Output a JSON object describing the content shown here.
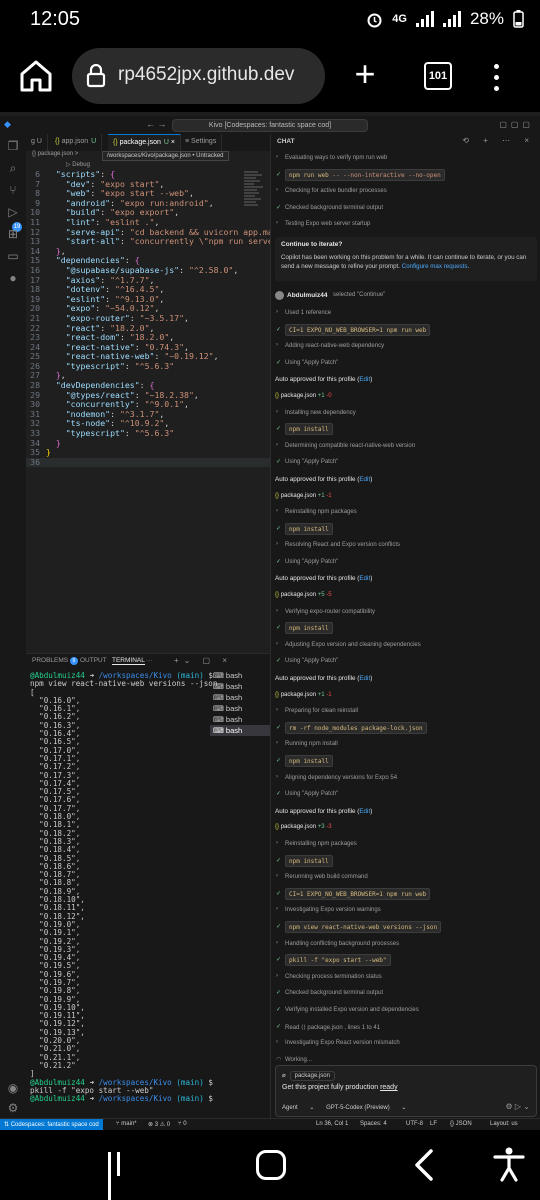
{
  "status_bar": {
    "time": "12:05",
    "network": "4G",
    "battery": "28%"
  },
  "browser": {
    "url": "rp4652jpx.github.dev",
    "tab_count": "101"
  },
  "vscode": {
    "command_center": "Kivo [Codespaces: fantastic space cod]",
    "tabs": [
      {
        "label": "g U"
      },
      {
        "label": "app.json",
        "status": "U"
      },
      {
        "label": "package.json",
        "status": "U"
      },
      {
        "label": "Settings"
      }
    ],
    "breadcrumb": "package.json >",
    "peek": "▷ Debug",
    "tooltip": "/workspaces/Kivo/package.json • Untracked",
    "code": [
      {
        "n": "6",
        "html": "  <span class='k'>\"scripts\"</span><span class='p'>: </span><span class='b2'>{</span>"
      },
      {
        "n": "7",
        "html": "    <span class='k'>\"dev\"</span><span class='p'>: </span><span class='s'>\"expo start\"</span><span class='p'>,</span>"
      },
      {
        "n": "8",
        "html": "    <span class='k'>\"web\"</span><span class='p'>: </span><span class='s'>\"expo start --web\"</span><span class='p'>,</span>"
      },
      {
        "n": "9",
        "html": "    <span class='k'>\"android\"</span><span class='p'>: </span><span class='s'>\"expo run:android\"</span><span class='p'>,</span>"
      },
      {
        "n": "10",
        "html": "    <span class='k'>\"build\"</span><span class='p'>: </span><span class='s'>\"expo export\"</span><span class='p'>,</span>"
      },
      {
        "n": "11",
        "html": "    <span class='k'>\"lint\"</span><span class='p'>: </span><span class='s'>\"eslint .\"</span><span class='p'>,</span>"
      },
      {
        "n": "12",
        "html": "    <span class='k'>\"serve-api\"</span><span class='p'>: </span><span class='s'>\"cd backend &amp;&amp; uvicorn app.ma</span>"
      },
      {
        "n": "13",
        "html": "    <span class='k'>\"start-all\"</span><span class='p'>: </span><span class='s'>\"concurrently \\\"npm run serve</span>"
      },
      {
        "n": "14",
        "html": "  <span class='b2'>}</span><span class='p'>,</span>"
      },
      {
        "n": "15",
        "html": "  <span class='k'>\"dependencies\"</span><span class='p'>: </span><span class='b2'>{</span>"
      },
      {
        "n": "16",
        "html": "    <span class='k'>\"@supabase/supabase-js\"</span><span class='p'>: </span><span class='s'>\"^2.58.0\"</span><span class='p'>,</span>"
      },
      {
        "n": "17",
        "html": "    <span class='k'>\"axios\"</span><span class='p'>: </span><span class='s'>\"^1.7.7\"</span><span class='p'>,</span>"
      },
      {
        "n": "18",
        "html": "    <span class='k'>\"dotenv\"</span><span class='p'>: </span><span class='s'>\"^16.4.5\"</span><span class='p'>,</span>"
      },
      {
        "n": "19",
        "html": "    <span class='k'>\"eslint\"</span><span class='p'>: </span><span class='s'>\"^9.13.0\"</span><span class='p'>,</span>"
      },
      {
        "n": "20",
        "html": "    <span class='k'>\"expo\"</span><span class='p'>: </span><span class='s'>\"~54.0.12\"</span><span class='p'>,</span>"
      },
      {
        "n": "21",
        "html": "    <span class='k'>\"expo-router\"</span><span class='p'>: </span><span class='s'>\"~3.5.17\"</span><span class='p'>,</span>"
      },
      {
        "n": "22",
        "html": "    <span class='k'>\"react\"</span><span class='p'>: </span><span class='s'>\"18.2.0\"</span><span class='p'>,</span>"
      },
      {
        "n": "23",
        "html": "    <span class='k'>\"react-dom\"</span><span class='p'>: </span><span class='s'>\"18.2.0\"</span><span class='p'>,</span>"
      },
      {
        "n": "24",
        "html": "    <span class='k'>\"react-native\"</span><span class='p'>: </span><span class='s'>\"0.74.3\"</span><span class='p'>,</span>"
      },
      {
        "n": "25",
        "html": "    <span class='k'>\"react-native-web\"</span><span class='p'>: </span><span class='s'>\"~0.19.12\"</span><span class='p'>,</span>"
      },
      {
        "n": "26",
        "html": "    <span class='k'>\"typescript\"</span><span class='p'>: </span><span class='s'>\"^5.6.3\"</span>"
      },
      {
        "n": "27",
        "html": "  <span class='b2'>}</span><span class='p'>,</span>"
      },
      {
        "n": "28",
        "html": "  <span class='k'>\"devDependencies\"</span><span class='p'>: </span><span class='b2'>{</span>"
      },
      {
        "n": "29",
        "html": "    <span class='k'>\"@types/react\"</span><span class='p'>: </span><span class='s'>\"~18.2.38\"</span><span class='p'>,</span>"
      },
      {
        "n": "30",
        "html": "    <span class='k'>\"concurrently\"</span><span class='p'>: </span><span class='s'>\"^9.0.1\"</span><span class='p'>,</span>"
      },
      {
        "n": "31",
        "html": "    <span class='k'>\"nodemon\"</span><span class='p'>: </span><span class='s'>\"^3.1.7\"</span><span class='p'>,</span>"
      },
      {
        "n": "32",
        "html": "    <span class='k'>\"ts-node\"</span><span class='p'>: </span><span class='s'>\"^10.9.2\"</span><span class='p'>,</span>"
      },
      {
        "n": "33",
        "html": "    <span class='k'>\"typescript\"</span><span class='p'>: </span><span class='s'>\"^5.6.3\"</span>"
      },
      {
        "n": "34",
        "html": "  <span class='b2'>}</span>"
      },
      {
        "n": "35",
        "html": "<span class='b'>}</span>"
      },
      {
        "n": "36",
        "html": ""
      }
    ],
    "panel": {
      "tabs": [
        "PROBLEMS",
        "OUTPUT",
        "TERMINAL",
        "···"
      ],
      "problems_count": "9",
      "terminal_list": [
        "bash",
        "bash",
        "bash",
        "bash",
        "bash",
        "bash"
      ],
      "terminal_html": "<span class='pr'>@Abdulmuiz44</span> <span class='p'>➜</span> <span class='dir'>/workspaces/Kivo</span> <span class='br'>(main)</span> $\nnpm view react-native-web versions --json\n[\n  \"0.16.0\",\n  \"0.16.1\",\n  \"0.16.2\",\n  \"0.16.3\",\n  \"0.16.4\",\n  \"0.16.5\",\n  \"0.17.0\",\n  \"0.17.1\",\n  \"0.17.2\",\n  \"0.17.3\",\n  \"0.17.4\",\n  \"0.17.5\",\n  \"0.17.6\",\n  \"0.17.7\",\n  \"0.18.0\",\n  \"0.18.1\",\n  \"0.18.2\",\n  \"0.18.3\",\n  \"0.18.4\",\n  \"0.18.5\",\n  \"0.18.6\",\n  \"0.18.7\",\n  \"0.18.8\",\n  \"0.18.9\",\n  \"0.18.10\",\n  \"0.18.11\",\n  \"0.18.12\",\n  \"0.19.0\",\n  \"0.19.1\",\n  \"0.19.2\",\n  \"0.19.3\",\n  \"0.19.4\",\n  \"0.19.5\",\n  \"0.19.6\",\n  \"0.19.7\",\n  \"0.19.8\",\n  \"0.19.9\",\n  \"0.19.10\",\n  \"0.19.11\",\n  \"0.19.12\",\n  \"0.19.13\",\n  \"0.20.0\",\n  \"0.21.0\",\n  \"0.21.1\",\n  \"0.21.2\"\n]\n<span class='pr'>@Abdulmuiz44</span> <span class='p'>➜</span> <span class='dir'>/workspaces/Kivo</span> <span class='br'>(main)</span> $\npkill -f \"expo start --web\"\n<span class='pr'>@Abdulmuiz44</span> <span class='p'>➜</span> <span class='dir'>/workspaces/Kivo</span> <span class='br'>(main)</span> $"
    },
    "chat": {
      "header": "CHAT",
      "items": [
        {
          "k": "txt",
          "g": "›",
          "t": "Evaluating ways to verify npm run web"
        },
        {
          "k": "code",
          "g": "✓",
          "t": "<span class='kw'>npm run web</span> <span class='ag'>-- --non-interactive --no-open</span>"
        },
        {
          "k": "txt",
          "g": "›",
          "t": "Checking for active bundler processes"
        },
        {
          "k": "txt",
          "g": "✓",
          "ok": true,
          "t": "Checked background terminal output"
        },
        {
          "k": "txt",
          "g": "›",
          "t": "Testing Expo web server startup"
        },
        {
          "k": "note",
          "t": "Continue to iterate?",
          "d": "Copilot has been working on this problem for a while. It can continue to iterate, or you can send a new message to refine your prompt. <a>Configure max requests</a>."
        },
        {
          "k": "user",
          "name": "Abdulmuiz44",
          "sel": "selected \"Continue\""
        },
        {
          "k": "txt",
          "g": "›",
          "t": "Used 1 reference"
        },
        {
          "k": "code",
          "g": "✓",
          "t": "<span class='kw'>CI=1 EXPO_NO_WEB_BROWSER=1 npm run web</span>"
        },
        {
          "k": "txt",
          "g": "›",
          "t": "Adding react-native-web dependency"
        },
        {
          "k": "txt",
          "g": "✓",
          "ok": true,
          "t": "Using \"Apply Patch\""
        },
        {
          "k": "auto",
          "t": "Auto approved for this profile (",
          "e": "Edit",
          "z": ")"
        },
        {
          "k": "file",
          "f": "package.json",
          "p": "+1",
          "m": "-0"
        },
        {
          "k": "txt",
          "g": "›",
          "t": "Installing new dependency"
        },
        {
          "k": "code",
          "g": "✓",
          "t": "<span class='kw'>npm install</span>"
        },
        {
          "k": "txt",
          "g": "›",
          "t": "Determining compatible react-native-web version"
        },
        {
          "k": "txt",
          "g": "✓",
          "ok": true,
          "t": "Using \"Apply Patch\""
        },
        {
          "k": "auto",
          "t": "Auto approved for this profile (",
          "e": "Edit",
          "z": ")"
        },
        {
          "k": "file",
          "f": "package.json",
          "p": "+1",
          "m": "-1"
        },
        {
          "k": "txt",
          "g": "›",
          "t": "Reinstalling npm packages"
        },
        {
          "k": "code",
          "g": "✓",
          "t": "<span class='kw'>npm install</span>"
        },
        {
          "k": "txt",
          "g": "›",
          "t": "Resolving React and Expo version conflicts"
        },
        {
          "k": "txt",
          "g": "✓",
          "ok": true,
          "t": "Using \"Apply Patch\""
        },
        {
          "k": "auto",
          "t": "Auto approved for this profile (",
          "e": "Edit",
          "z": ")"
        },
        {
          "k": "file",
          "f": "package.json",
          "p": "+5",
          "m": "-5"
        },
        {
          "k": "txt",
          "g": "›",
          "t": "Verifying expo-router compatibility"
        },
        {
          "k": "code",
          "g": "✓",
          "t": "<span class='kw'>npm install</span>"
        },
        {
          "k": "txt",
          "g": "›",
          "t": "Adjusting Expo version and cleaning dependencies"
        },
        {
          "k": "txt",
          "g": "✓",
          "ok": true,
          "t": "Using \"Apply Patch\""
        },
        {
          "k": "auto",
          "t": "Auto approved for this profile (",
          "e": "Edit",
          "z": ")"
        },
        {
          "k": "file",
          "f": "package.json",
          "p": "+1",
          "m": "-1"
        },
        {
          "k": "txt",
          "g": "›",
          "t": "Preparing for clean reinstall"
        },
        {
          "k": "code",
          "g": "✓",
          "t": "<span class='kw'>rm -rf node_modules package-lock.json</span>"
        },
        {
          "k": "txt",
          "g": "›",
          "t": "Running npm install"
        },
        {
          "k": "code",
          "g": "✓",
          "t": "<span class='kw'>npm install</span>"
        },
        {
          "k": "txt",
          "g": "›",
          "t": "Aligning dependency versions for Expo 54"
        },
        {
          "k": "txt",
          "g": "✓",
          "ok": true,
          "t": "Using \"Apply Patch\""
        },
        {
          "k": "auto",
          "t": "Auto approved for this profile (",
          "e": "Edit",
          "z": ")"
        },
        {
          "k": "file",
          "f": "package.json",
          "p": "+3",
          "m": "-3"
        },
        {
          "k": "txt",
          "g": "›",
          "t": "Reinstalling npm packages"
        },
        {
          "k": "code",
          "g": "✓",
          "t": "<span class='kw'>npm install</span>"
        },
        {
          "k": "txt",
          "g": "›",
          "t": "Rerunning web build command"
        },
        {
          "k": "code",
          "g": "✓",
          "t": "<span class='kw'>CI=1 EXPO_NO_WEB_BROWSER=1 npm run web</span>"
        },
        {
          "k": "txt",
          "g": "›",
          "t": "Investigating Expo version warnings"
        },
        {
          "k": "code",
          "g": "✓",
          "t": "<span class='kw'>npm view react-native-web versions --json</span>"
        },
        {
          "k": "txt",
          "g": "›",
          "t": "Handling conflicting background processes"
        },
        {
          "k": "code",
          "g": "✓",
          "t": "<span class='kw'>pkill -f \"expo start --web\"</span>"
        },
        {
          "k": "txt",
          "g": "›",
          "t": "Checking process termination status"
        },
        {
          "k": "txt",
          "g": "✓",
          "ok": true,
          "t": "Checked background terminal output"
        },
        {
          "k": "txt",
          "g": "✓",
          "ok": true,
          "t": "Verifying installed Expo version and dependencies"
        },
        {
          "k": "txt",
          "g": "✓",
          "ok": true,
          "t": "Read  ⟨⟩ package.json , lines 1 to 41"
        },
        {
          "k": "txt",
          "g": "›",
          "t": "Investigating Expo React version mismatch"
        },
        {
          "k": "txt",
          "g": "◠",
          "t": "Working..."
        }
      ],
      "input": {
        "context_chip": "package.json",
        "prompt_text": "Get this project fully production ",
        "prompt_ready": "ready",
        "mode": "Agent",
        "model": "GPT-5-Codex (Preview)"
      }
    },
    "status": {
      "remote": "Codespaces: fantastic space cod",
      "branch": "main*",
      "problems": "⊗ 3 ⚠ 0",
      "ports": "⑂ 0",
      "position": "Ln 36, Col 1",
      "spaces": "Spaces: 4",
      "encoding": "UTF-8",
      "eol": "LF",
      "language": "{} JSON",
      "layout": "Layout: us"
    }
  }
}
